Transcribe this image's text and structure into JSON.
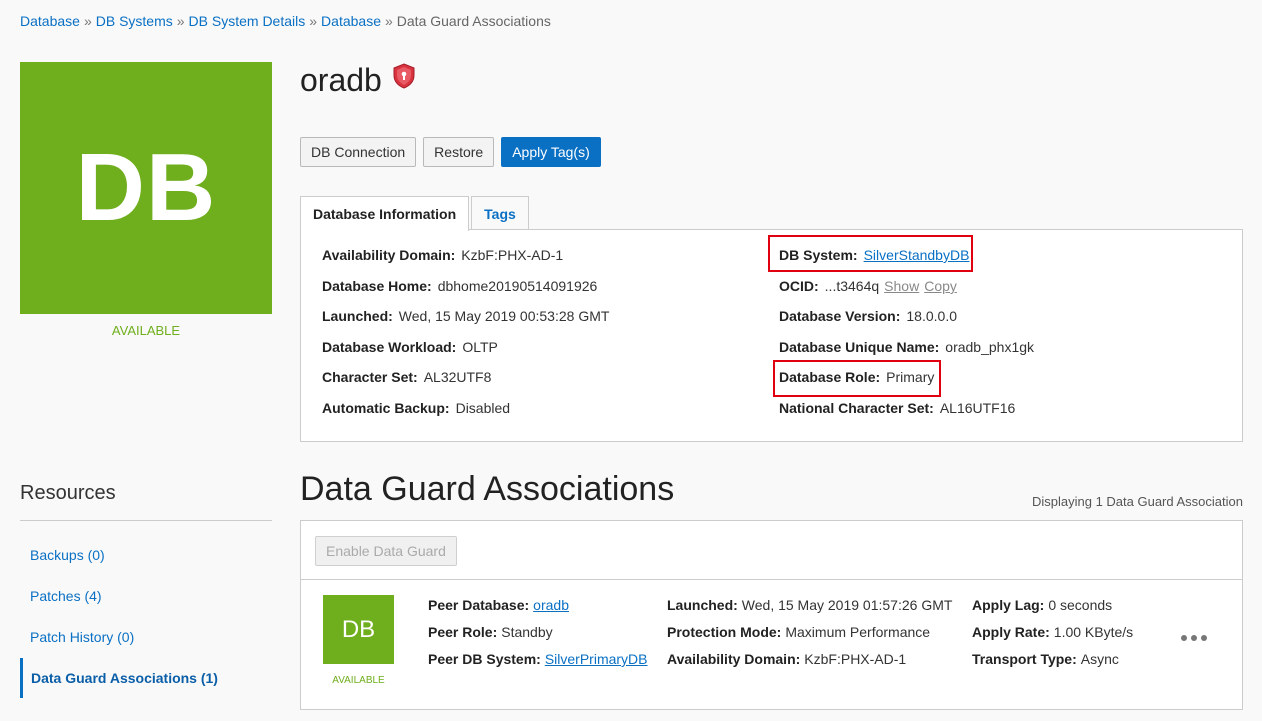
{
  "breadcrumb": {
    "items": [
      "Database",
      "DB Systems",
      "DB System Details",
      "Database"
    ],
    "separator": "»",
    "current": "Data Guard Associations"
  },
  "tile": {
    "text": "DB",
    "status": "AVAILABLE",
    "color": "#6fae1c"
  },
  "title": {
    "name": "oradb",
    "badge_icon": "security-shield-icon"
  },
  "actions": {
    "connection": "DB Connection",
    "restore": "Restore",
    "apply_tags": "Apply Tag(s)"
  },
  "tabs": {
    "info": "Database Information",
    "tags": "Tags"
  },
  "info": {
    "availability_domain": {
      "label": "Availability Domain:",
      "value": "KzbF:PHX-AD-1"
    },
    "database_home": {
      "label": "Database Home:",
      "value": "dbhome20190514091926"
    },
    "launched": {
      "label": "Launched:",
      "value": "Wed, 15 May 2019 00:53:28 GMT"
    },
    "workload": {
      "label": "Database Workload:",
      "value": "OLTP"
    },
    "charset": {
      "label": "Character Set:",
      "value": "AL32UTF8"
    },
    "auto_backup": {
      "label": "Automatic Backup:",
      "value": "Disabled"
    },
    "db_system": {
      "label": "DB System:",
      "value": "SilverStandbyDB"
    },
    "ocid": {
      "label": "OCID:",
      "value": "...t3464q",
      "show": "Show",
      "copy": "Copy"
    },
    "version": {
      "label": "Database Version:",
      "value": "18.0.0.0"
    },
    "unique_name": {
      "label": "Database Unique Name:",
      "value": "oradb_phx1gk"
    },
    "role": {
      "label": "Database Role:",
      "value": "Primary"
    },
    "ncharset": {
      "label": "National Character Set:",
      "value": "AL16UTF16"
    }
  },
  "resources": {
    "title": "Resources",
    "items": [
      "Backups (0)",
      "Patches (4)",
      "Patch History (0)",
      "Data Guard Associations (1)"
    ]
  },
  "dataguard": {
    "title": "Data Guard Associations",
    "count": "Displaying 1 Data Guard Association",
    "enable_button": "Enable Data Guard",
    "row": {
      "tile": "DB",
      "status": "AVAILABLE",
      "peer_database": {
        "label": "Peer Database:",
        "value": "oradb"
      },
      "peer_role": {
        "label": "Peer Role:",
        "value": "Standby"
      },
      "peer_db_system": {
        "label": "Peer DB System:",
        "value": "SilverPrimaryDB"
      },
      "launched": {
        "label": "Launched:",
        "value": "Wed, 15 May 2019 01:57:26 GMT"
      },
      "protection_mode": {
        "label": "Protection Mode:",
        "value": "Maximum Performance"
      },
      "availability_domain": {
        "label": "Availability Domain:",
        "value": "KzbF:PHX-AD-1"
      },
      "apply_lag": {
        "label": "Apply Lag:",
        "value": "0 seconds"
      },
      "apply_rate": {
        "label": "Apply Rate:",
        "value": "1.00 KByte/s"
      },
      "transport_type": {
        "label": "Transport Type:",
        "value": "Async"
      }
    }
  },
  "colors": {
    "accent": "#0a70c4",
    "available": "#6fae1c",
    "highlight": "#e0000f"
  }
}
